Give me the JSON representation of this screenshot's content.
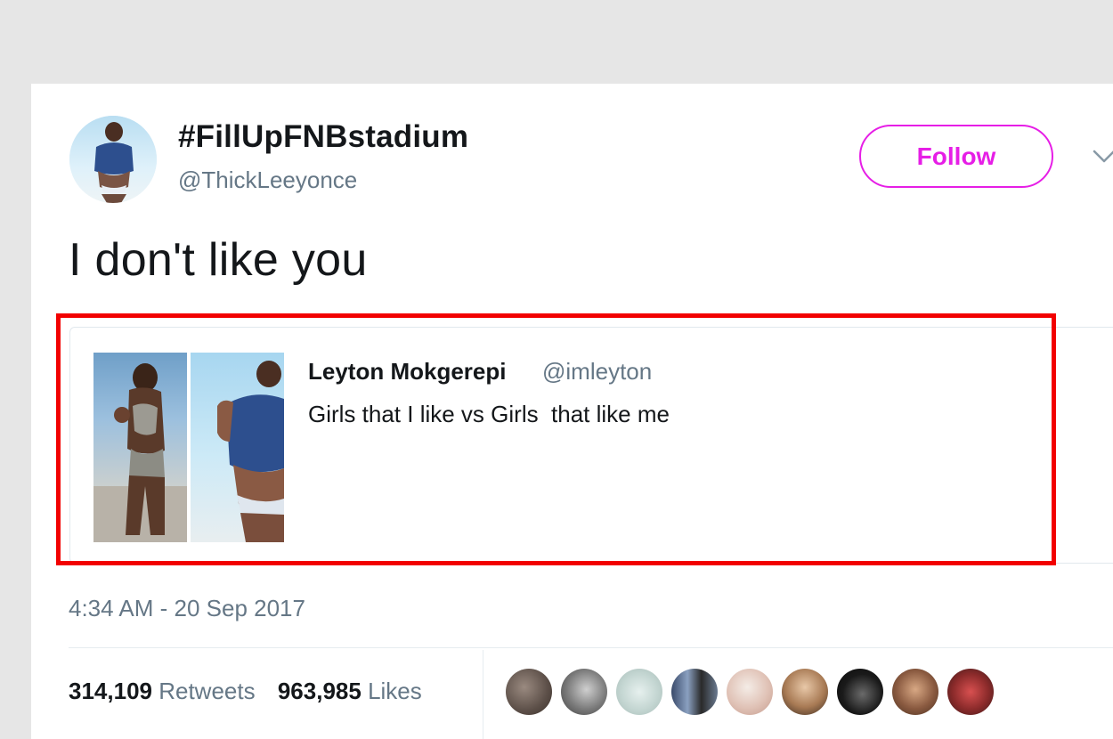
{
  "tweet": {
    "display_name": "#FillUpFNBstadium",
    "handle": "@ThickLeeyonce",
    "follow_label": "Follow",
    "text": "I don't like you",
    "timestamp": "4:34 AM - 20 Sep 2017",
    "retweets_count": "314,109",
    "retweets_label": "Retweets",
    "likes_count": "963,985",
    "likes_label": "Likes"
  },
  "quoted_tweet": {
    "name": "Leyton Mokgerepi",
    "handle": "@imleyton",
    "text": "Girls that I like vs Girls  that like me"
  },
  "colors": {
    "follow_accent": "#e61ee6",
    "highlight_box": "#f20000",
    "secondary_text": "#657786",
    "primary_text": "#14171a"
  },
  "icons": {
    "caret": "chevron-down-icon"
  }
}
